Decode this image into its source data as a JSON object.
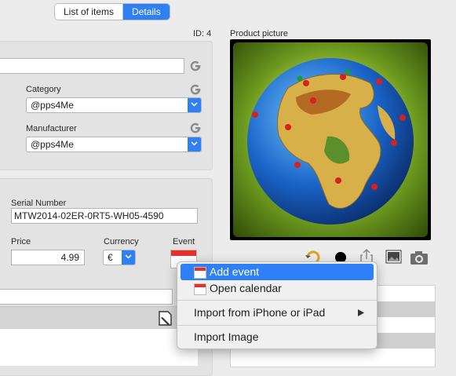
{
  "tabs": {
    "list_label": "List of items",
    "details_label": "Details"
  },
  "item": {
    "id_text": "ID: 4",
    "name_value": "",
    "category_label": "Category",
    "category_value": "@pps4Me",
    "manufacturer_label": "Manufacturer",
    "manufacturer_value": "@pps4Me"
  },
  "purchase": {
    "serial_label": "Serial Number",
    "serial_value": "MTW2014-02ER-0RT5-WH05-4590",
    "price_label": "Price",
    "price_value": "4.99",
    "currency_label": "Currency",
    "currency_value": "€",
    "event_label": "Event",
    "note_value": ""
  },
  "picture": {
    "label": "Product picture"
  },
  "context_menu": {
    "add_event": "Add event",
    "open_calendar": "Open calendar",
    "import_iphone": "Import from iPhone or iPad",
    "import_image": "Import Image"
  },
  "colors": {
    "accent": "#2f80f5",
    "calendar_red": "#e5312c"
  },
  "icons": [
    "google-icon",
    "chevron-down-icon",
    "calendar-icon",
    "rotate-icon",
    "color-dot-icon",
    "share-icon",
    "image-edit-icon",
    "camera-icon",
    "edit-note-icon",
    "submenu-arrow-icon"
  ]
}
